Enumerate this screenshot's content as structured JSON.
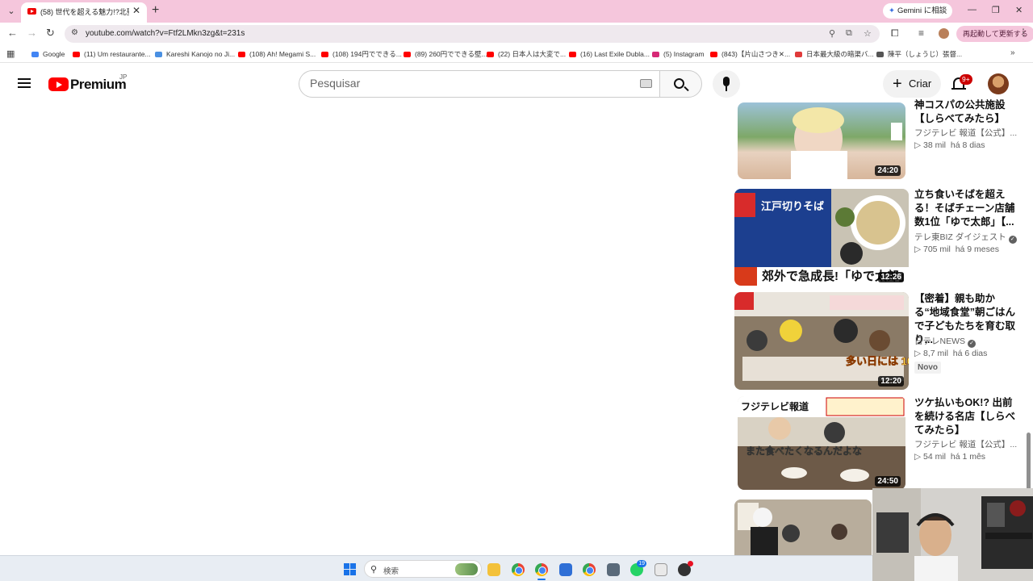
{
  "browser": {
    "tab_title": "(58) 世代を超える魅力!?北聖東Ｌ",
    "gemini_label": "Gemini に相談",
    "url": "youtube.com/watch?v=Ftf2LMkn3zg&t=231s",
    "relaunch_label": "再起動して更新する",
    "bookmarks": [
      {
        "label": "Google",
        "color": "#4285f4"
      },
      {
        "label": "(11) Um restaurante...",
        "color": "#ff0000"
      },
      {
        "label": "Kareshi Kanojo no Ji...",
        "color": "#4a90e2"
      },
      {
        "label": "(108) Ah! Megami S...",
        "color": "#ff0000"
      },
      {
        "label": "(108) 194円でできる...",
        "color": "#ff0000"
      },
      {
        "label": "(89) 260円でできる壁...",
        "color": "#ff0000"
      },
      {
        "label": "(22) 日本人は大変で...",
        "color": "#ff0000"
      },
      {
        "label": "(16) Last Exile Dubla...",
        "color": "#ff0000"
      },
      {
        "label": "(5) Instagram",
        "color": "#d62976"
      },
      {
        "label": "(843)【片山さつき✕...",
        "color": "#ff0000"
      },
      {
        "label": "日本最大級の暗渠バ...",
        "color": "#e03a3a"
      },
      {
        "label": "陳平（しょうじ）張督...",
        "color": "#555555"
      }
    ]
  },
  "masthead": {
    "logo_text": "Premium",
    "region": "JP",
    "search_placeholder": "Pesquisar",
    "create_label": "Criar",
    "notifications": "9+"
  },
  "related": [
    {
      "title": "神コスパの公共施設【しらべてみたら】",
      "channel": "フジテレビ 報道【公式】...",
      "verified": false,
      "views": "38 mil",
      "age": "há 8 dias",
      "duration": "24:20",
      "badge": ""
    },
    {
      "title": "立ち食いそばを超える！そばチェーン店舗数1位「ゆで太郎」【...",
      "channel": "テレ東BIZ ダイジェスト",
      "verified": true,
      "views": "705 mil",
      "age": "há 9 meses",
      "duration": "12:26",
      "badge": "",
      "thumb_caption": "郊外で急成長!「ゆで太郎」",
      "thumb_sign": "江戸切りそば"
    },
    {
      "title": "【密着】親も助かる“地域食堂”朝ごはんで子どもたちを育む取り...",
      "channel": "日テレNEWS",
      "verified": true,
      "views": "8,7 mil",
      "age": "há 6 dias",
      "duration": "12:20",
      "badge": "Novo",
      "thumb_caption": "多い日には 100人"
    },
    {
      "title": "ツケ払いもOK!? 出前を続ける名店【しらべてみたら】",
      "channel": "フジテレビ 報道【公式】...",
      "verified": false,
      "views": "54 mil",
      "age": "há 1 mês",
      "duration": "24:50",
      "badge": "",
      "thumb_brand": "フジテレビ報道",
      "thumb_caption": "また食べたくなるんだよな"
    }
  ],
  "taskbar": {
    "search_label": "検索",
    "whatsapp_count": "19"
  }
}
